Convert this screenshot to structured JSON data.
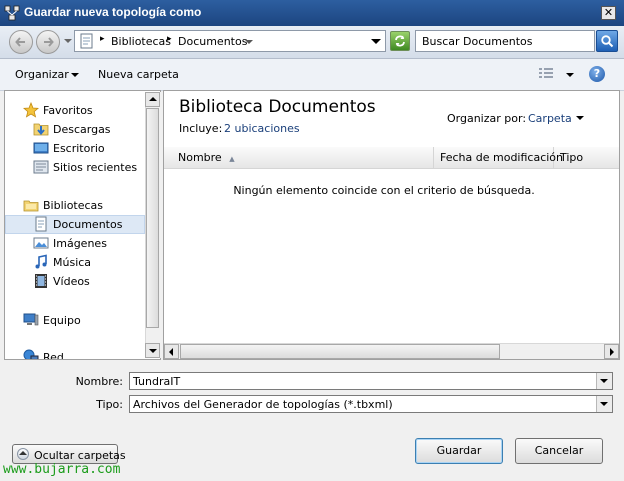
{
  "window": {
    "title": "Guardar nueva topología como",
    "close_glyph": "✕"
  },
  "navigation": {
    "breadcrumb": [
      "Bibliotecas",
      "Documentos"
    ],
    "search_placeholder": "Buscar Documentos"
  },
  "toolbar": {
    "organize_label": "Organizar",
    "new_folder_label": "Nueva carpeta",
    "help_glyph": "?"
  },
  "nav_pane": {
    "items": [
      {
        "label": "Favoritos",
        "icon": "star-icon"
      },
      {
        "label": "Descargas",
        "icon": "downloads-folder-icon"
      },
      {
        "label": "Escritorio",
        "icon": "desktop-icon"
      },
      {
        "label": "Sitios recientes",
        "icon": "recent-places-icon"
      },
      {
        "label": "Bibliotecas",
        "icon": "libraries-icon"
      },
      {
        "label": "Documentos",
        "icon": "documents-icon",
        "selected": true
      },
      {
        "label": "Imágenes",
        "icon": "pictures-icon"
      },
      {
        "label": "Música",
        "icon": "music-icon"
      },
      {
        "label": "Vídeos",
        "icon": "videos-icon"
      },
      {
        "label": "Equipo",
        "icon": "computer-icon"
      },
      {
        "label": "Red",
        "icon": "network-icon"
      }
    ]
  },
  "content": {
    "library_title": "Biblioteca Documentos",
    "includes_label": "Incluye:",
    "includes_value": "2 ubicaciones",
    "arrange_label": "Organizar por:",
    "arrange_value": "Carpeta",
    "columns": [
      "Nombre",
      "Fecha de modificación",
      "Tipo"
    ],
    "empty_message": "Ningún elemento coincide con el criterio de búsqueda."
  },
  "form": {
    "filename_label": "Nombre:",
    "filename_value": "TundraIT",
    "type_label": "Tipo:",
    "type_value": "Archivos del Generador de topologías (*.tbxml)"
  },
  "footer": {
    "hide_folders_label": "Ocultar carpetas",
    "save_label": "Guardar",
    "cancel_label": "Cancelar",
    "watermark": "www.bujarra.com"
  },
  "colors": {
    "titlebar": "#1c4580",
    "watermark": "#1b9c1b",
    "selection": "#dde8f5"
  }
}
